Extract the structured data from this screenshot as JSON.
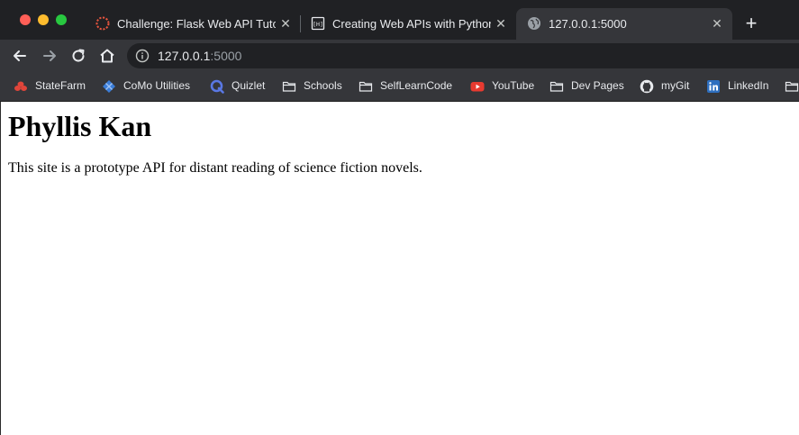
{
  "browser": {
    "tabs": [
      {
        "title": "Challenge: Flask Web API Tutor",
        "favicon": "dashed-circle-icon",
        "active": false
      },
      {
        "title": "Creating Web APIs with Python",
        "favicon": "ph-logo-icon",
        "active": false
      },
      {
        "title": "127.0.0.1:5000",
        "favicon": "globe-icon",
        "active": true
      }
    ],
    "new_tab": "+",
    "close_glyph": "✕",
    "address": {
      "host": "127.0.0.1",
      "port": ":5000"
    },
    "bookmarks": [
      {
        "label": "StateFarm",
        "icon": "statefarm-icon"
      },
      {
        "label": "CoMo Utilities",
        "icon": "como-utilities-icon"
      },
      {
        "label": "Quizlet",
        "icon": "quizlet-icon"
      },
      {
        "label": "Schools",
        "icon": "folder-icon"
      },
      {
        "label": "SelfLearnCode",
        "icon": "folder-icon"
      },
      {
        "label": "YouTube",
        "icon": "youtube-icon"
      },
      {
        "label": "Dev Pages",
        "icon": "folder-icon"
      },
      {
        "label": "myGit",
        "icon": "github-icon"
      },
      {
        "label": "LinkedIn",
        "icon": "linkedin-icon"
      }
    ],
    "colors": {
      "tabstrip": "#202124",
      "toolbar": "#35363a",
      "text": "#e8eaed"
    }
  },
  "page": {
    "heading": "Phyllis Kan",
    "paragraph": "This site is a prototype API for distant reading of science fiction novels."
  }
}
